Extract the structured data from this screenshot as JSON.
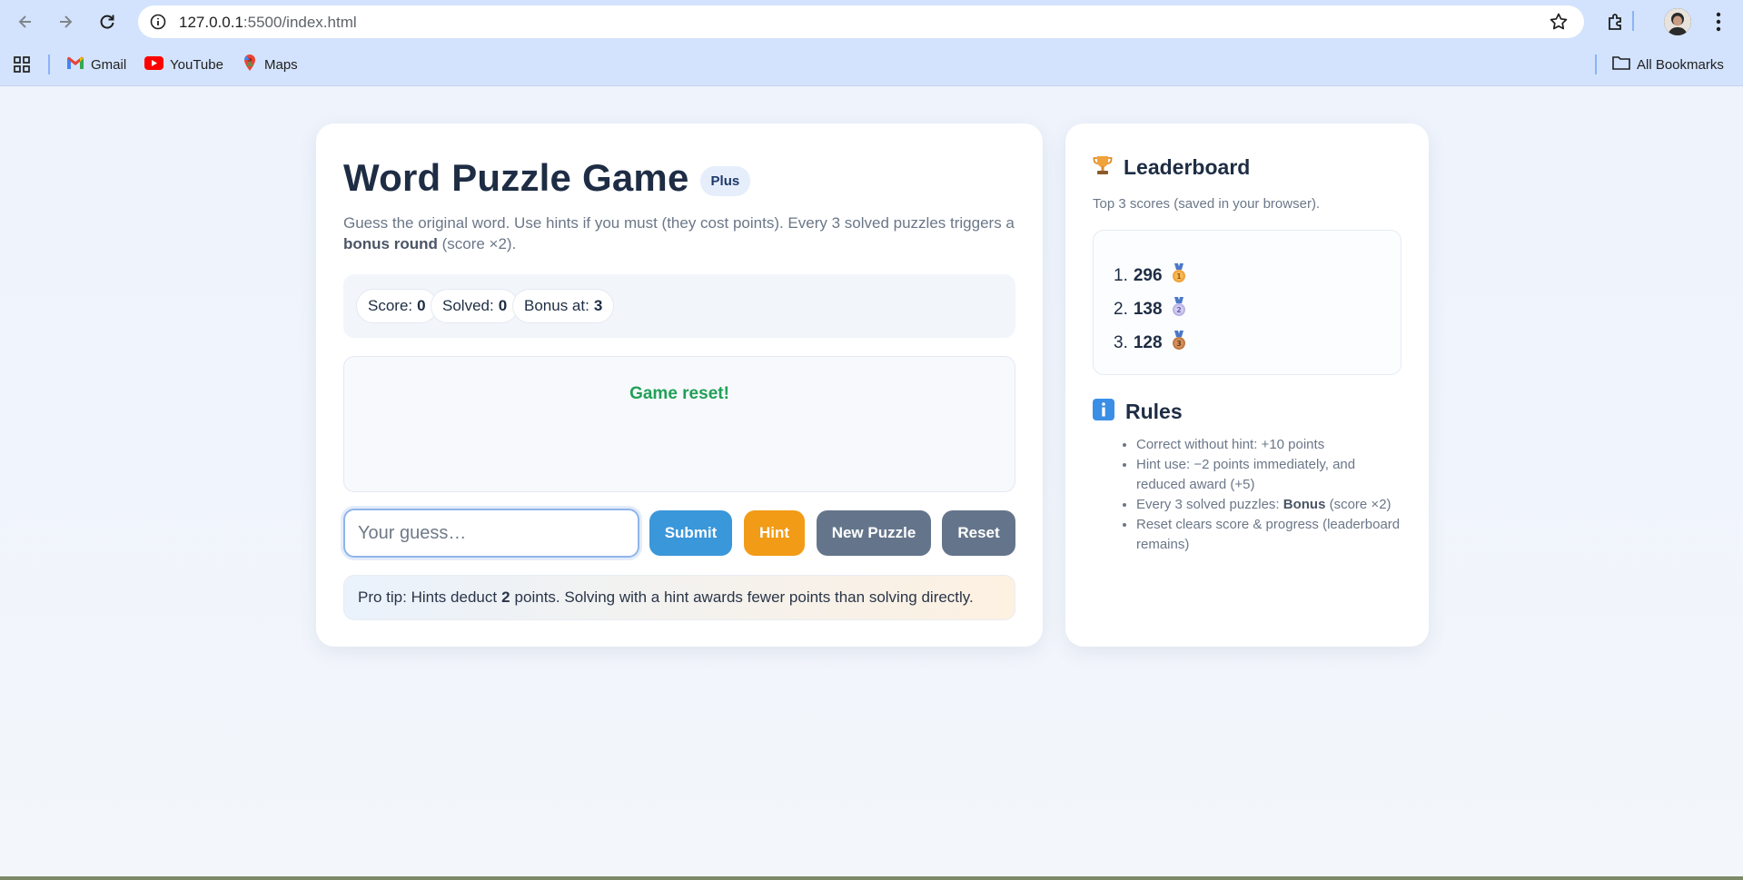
{
  "browser": {
    "url_host": "127.0.0.1",
    "url_path": ":5500/index.html",
    "bookmarks": [
      {
        "label": "Gmail",
        "icon": "gmail-icon"
      },
      {
        "label": "YouTube",
        "icon": "youtube-icon"
      },
      {
        "label": "Maps",
        "icon": "maps-icon"
      }
    ],
    "all_bookmarks_label": "All Bookmarks"
  },
  "game": {
    "title": "Word Puzzle Game",
    "badge": "Plus",
    "subtitle_part1": "Guess the original word. Use hints if you must (they cost points). Every 3 solved puzzles triggers a ",
    "subtitle_bold": "bonus round",
    "subtitle_part2": " (score ×2).",
    "stats": [
      {
        "label": "Score:",
        "value": "0"
      },
      {
        "label": "Solved:",
        "value": "0"
      },
      {
        "label": "Bonus at:",
        "value": "3"
      }
    ],
    "message": "Game reset!",
    "guess_placeholder": "Your guess…",
    "buttons": {
      "submit": "Submit",
      "hint": "Hint",
      "new_puzzle": "New Puzzle",
      "reset": "Reset"
    },
    "tip_part1": "Pro tip: Hints deduct",
    "tip_bold": "2",
    "tip_part2": "points. Solving with a hint awards fewer points than solving directly."
  },
  "leaderboard": {
    "title": "Leaderboard",
    "subtitle": "Top 3 scores (saved in your browser).",
    "entries": [
      {
        "rank": "1.",
        "score": "296",
        "medal": "gold-medal-icon"
      },
      {
        "rank": "2.",
        "score": "138",
        "medal": "silver-medal-icon"
      },
      {
        "rank": "3.",
        "score": "128",
        "medal": "bronze-medal-icon"
      }
    ]
  },
  "rules": {
    "title": "Rules",
    "items": [
      "Correct without hint: +10 points",
      "Hint use: −2 points immediately, and reduced award (+5)",
      "Reset clears score & progress (leaderboard remains)"
    ],
    "bonus_item_part1": "Every 3 solved puzzles: ",
    "bonus_item_bold": "Bonus",
    "bonus_item_part2": " (score ×2)"
  },
  "colors": {
    "submit": "#3a97d9",
    "hint": "#f29b16",
    "secondary": "#64758b",
    "success_message": "#21a056",
    "gold": "#f0a23b",
    "silver": "#b9b4e6",
    "bronze": "#c07a45"
  }
}
